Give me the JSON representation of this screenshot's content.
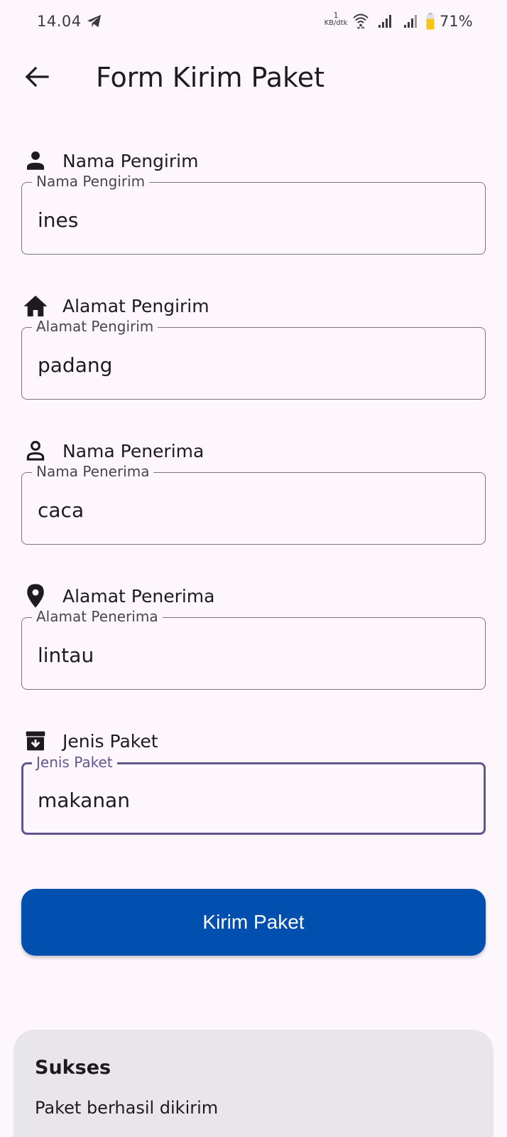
{
  "status_bar": {
    "time": "14.04",
    "net_speed_value": "1",
    "net_speed_unit": "KB/dtk",
    "battery_percent": "71%",
    "battery_color": "#f5c518"
  },
  "app_bar": {
    "back_icon": "arrow-back-icon",
    "title": "Form Kirim Paket"
  },
  "fields": [
    {
      "icon": "person-icon",
      "title": "Nama Pengirim",
      "label": "Nama Pengirim",
      "value": "ines",
      "focused": false
    },
    {
      "icon": "home-icon",
      "title": "Alamat Pengirim",
      "label": "Alamat Pengirim",
      "value": "padang",
      "focused": false
    },
    {
      "icon": "person-outline-icon",
      "title": "Nama Penerima",
      "label": "Nama Penerima",
      "value": "caca",
      "focused": false
    },
    {
      "icon": "location-pin-icon",
      "title": "Alamat Penerima",
      "label": "Alamat Penerima",
      "value": "lintau",
      "focused": false
    },
    {
      "icon": "archive-icon",
      "title": "Jenis Paket",
      "label": "Jenis Paket",
      "value": "makanan",
      "focused": true
    }
  ],
  "submit": {
    "label": "Kirim Paket",
    "color": "#014faf"
  },
  "dialog": {
    "title": "Sukses",
    "message": "Paket berhasil dikirim"
  },
  "colors": {
    "background": "#fdf7fd",
    "focus_accent": "#65558f",
    "outline": "#79747e"
  }
}
